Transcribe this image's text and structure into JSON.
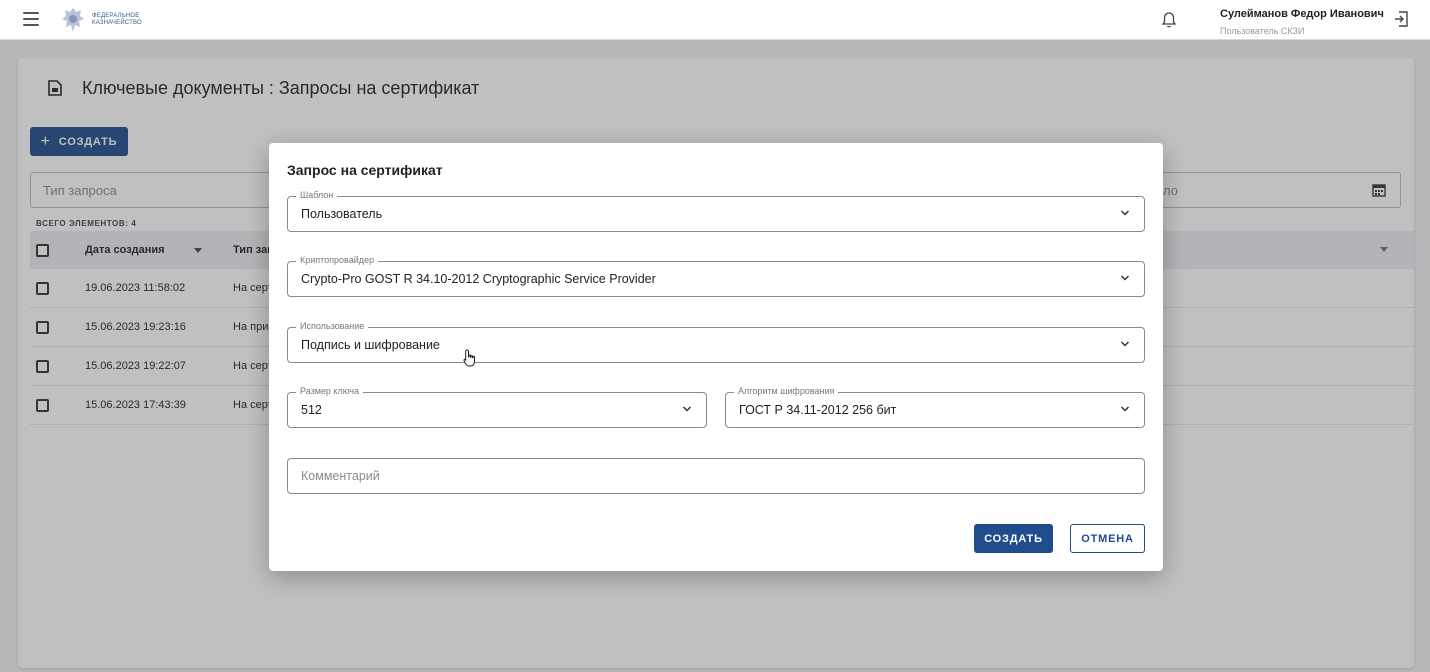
{
  "header": {
    "logo_text_line1": "ФЕДЕРАЛЬНОЕ",
    "logo_text_line2": "КАЗНАЧЕЙСТВО",
    "user_name": "Сулейманов Федор Иванович",
    "user_role": "Пользователь СКЗИ"
  },
  "page": {
    "title": "Ключевые документы : Запросы на сертификат",
    "create_label": "СОЗДАТЬ",
    "filter_request_type_placeholder": "Тип запроса",
    "filter_date_placeholder": "ло",
    "total_label": "ВСЕГО ЭЛЕМЕНТОВ: 4",
    "table": {
      "columns": [
        "Дата создания",
        "Тип зап"
      ],
      "rows": [
        {
          "date": "19.06.2023 11:58:02",
          "type": "На серт"
        },
        {
          "date": "15.06.2023 19:23:16",
          "type": "На при"
        },
        {
          "date": "15.06.2023 19:22:07",
          "type": "На серт"
        },
        {
          "date": "15.06.2023 17:43:39",
          "type": "На серт"
        }
      ]
    }
  },
  "dialog": {
    "title": "Запрос на сертификат",
    "fields": {
      "template": {
        "label": "Шаблон",
        "value": "Пользователь"
      },
      "crypto_provider": {
        "label": "Криптопровайдер",
        "value": "Crypto-Pro GOST R 34.10-2012 Cryptographic Service Provider"
      },
      "usage": {
        "label": "Использование",
        "value": "Подпись и шифрование"
      },
      "key_size": {
        "label": "Размер ключа",
        "value": "512"
      },
      "encryption_algorithm": {
        "label": "Алгоритм шифрования",
        "value": "ГОСТ Р 34.11-2012 256 бит"
      },
      "comment": {
        "placeholder": "Комментарий"
      }
    },
    "create_label": "СОЗДАТЬ",
    "cancel_label": "ОТМЕНА"
  },
  "colors": {
    "primary": "#1e4c8c",
    "overlay": "#3c3c3c"
  },
  "icons": [
    "menu-icon",
    "logo-emblem-icon",
    "bell-icon",
    "logout-icon",
    "document-icon",
    "plus-icon",
    "calendar-icon",
    "chevron-down-icon",
    "hand-cursor-icon"
  ]
}
